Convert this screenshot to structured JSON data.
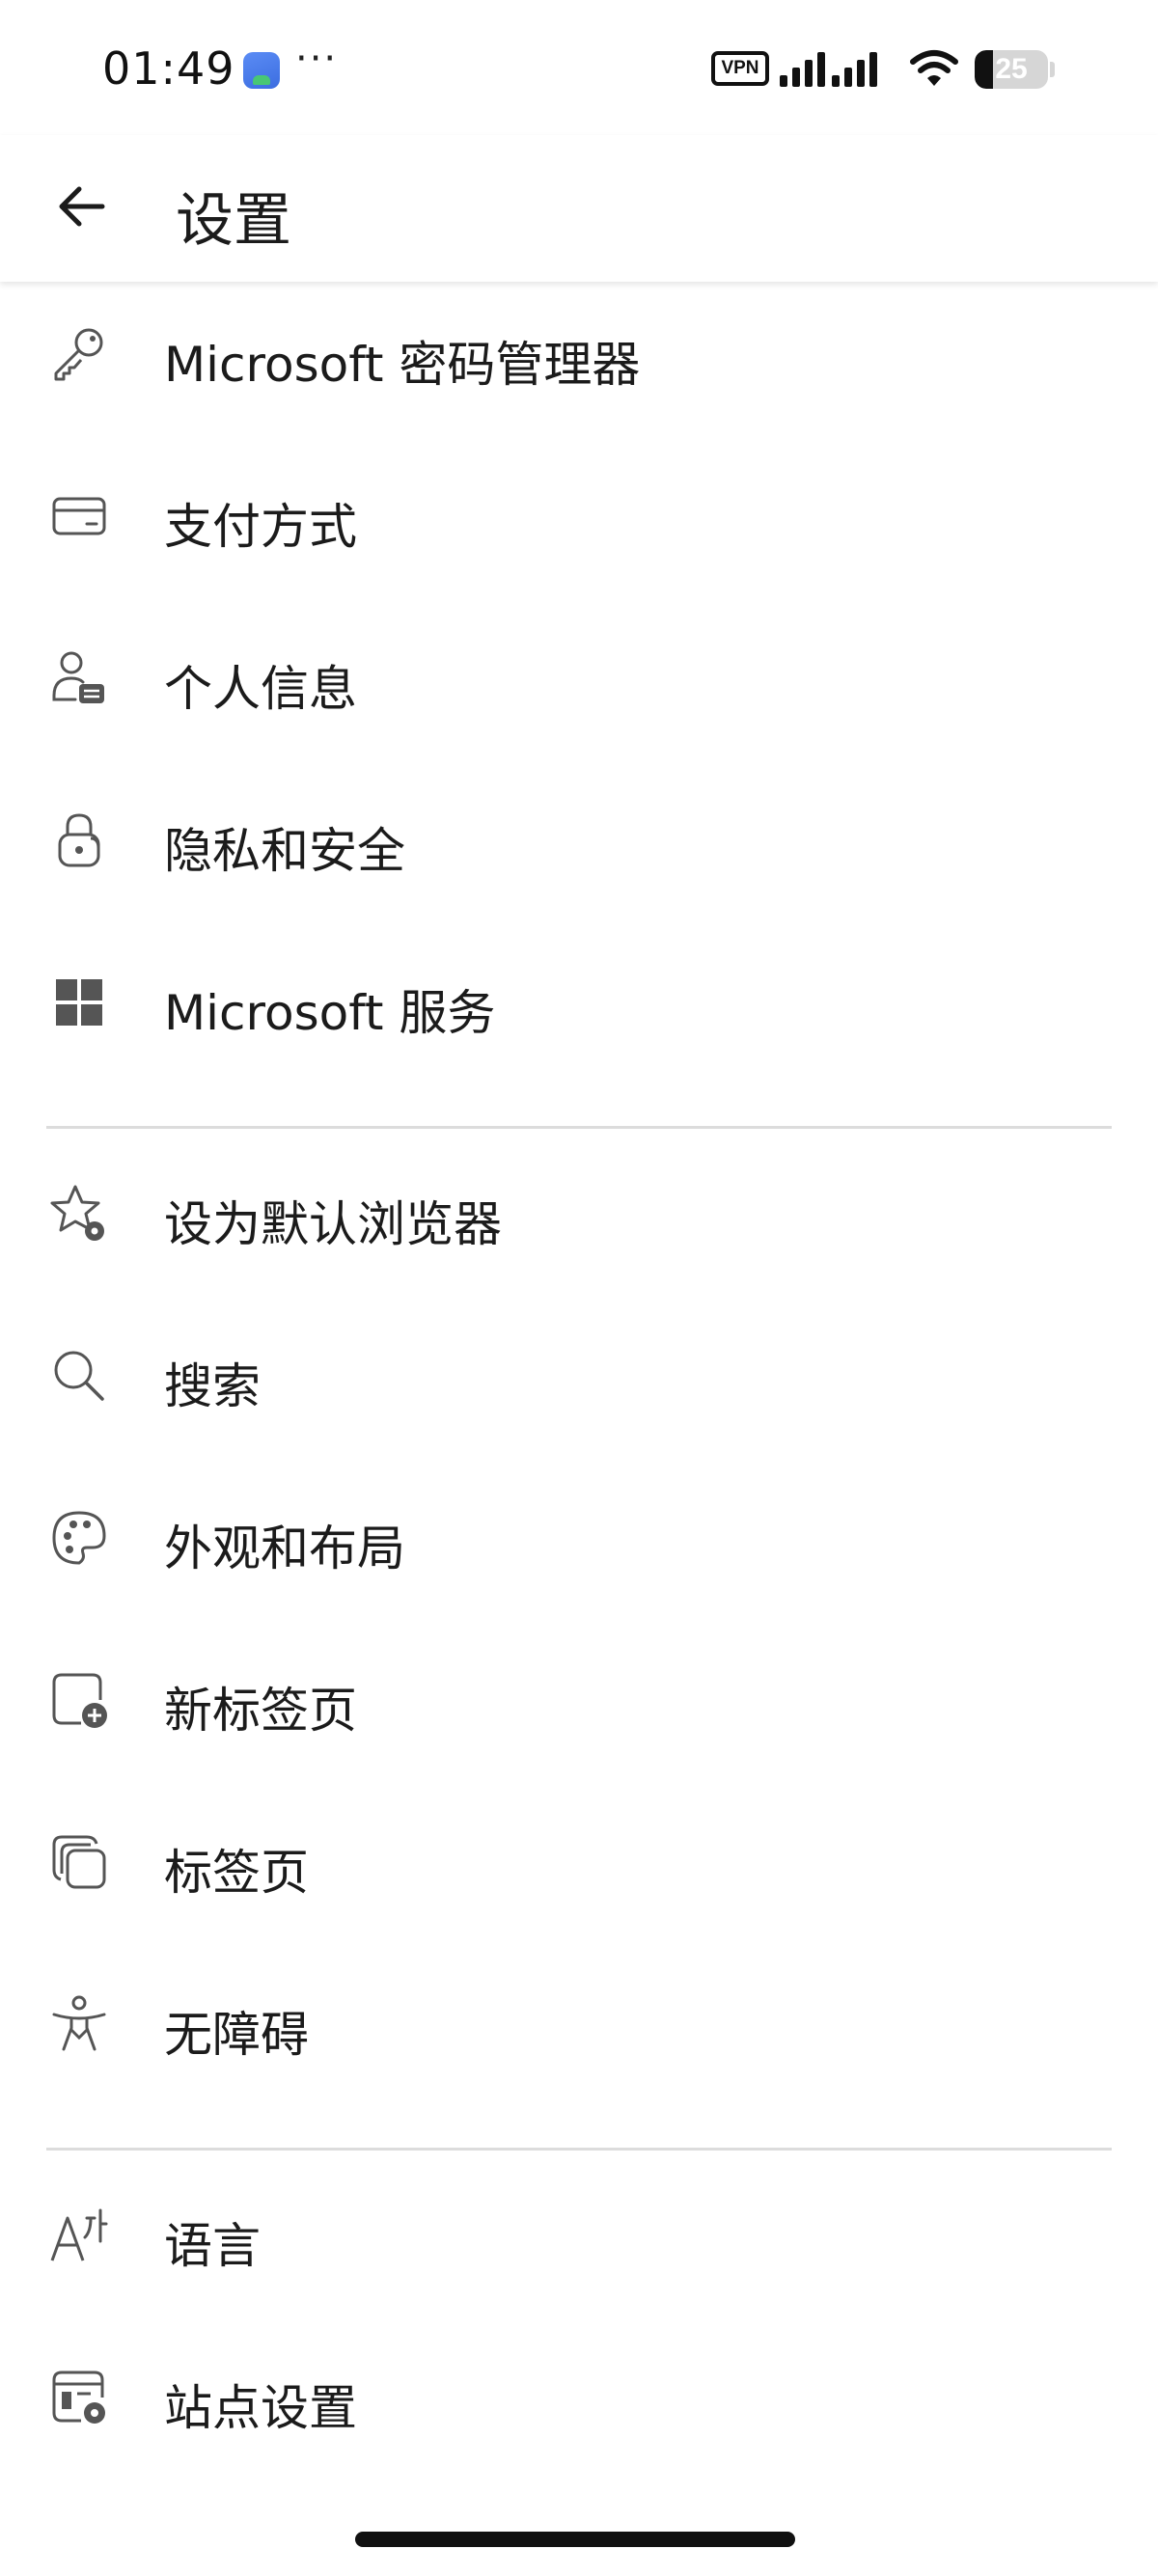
{
  "status_bar": {
    "time": "01:49",
    "more": "···",
    "vpn": "VPN",
    "battery": "25",
    "battery_level_percent": 25
  },
  "header": {
    "title": "设置",
    "back_icon": "arrow-left-icon"
  },
  "sections": [
    {
      "items": [
        {
          "label": "Microsoft 密码管理器",
          "icon": "key-icon"
        },
        {
          "label": "支付方式",
          "icon": "credit-card-icon"
        },
        {
          "label": "个人信息",
          "icon": "person-card-icon"
        },
        {
          "label": "隐私和安全",
          "icon": "lock-icon"
        },
        {
          "label": "Microsoft 服务",
          "icon": "grid-icon"
        }
      ]
    },
    {
      "items": [
        {
          "label": "设为默认浏览器",
          "icon": "star-gear-icon"
        },
        {
          "label": "搜索",
          "icon": "search-icon"
        },
        {
          "label": "外观和布局",
          "icon": "palette-icon"
        },
        {
          "label": "新标签页",
          "icon": "new-tab-icon"
        },
        {
          "label": "标签页",
          "icon": "tabs-icon"
        },
        {
          "label": "无障碍",
          "icon": "accessibility-icon"
        }
      ]
    },
    {
      "items": [
        {
          "label": "语言",
          "icon": "language-icon"
        },
        {
          "label": "站点设置",
          "icon": "site-settings-icon"
        }
      ]
    }
  ]
}
